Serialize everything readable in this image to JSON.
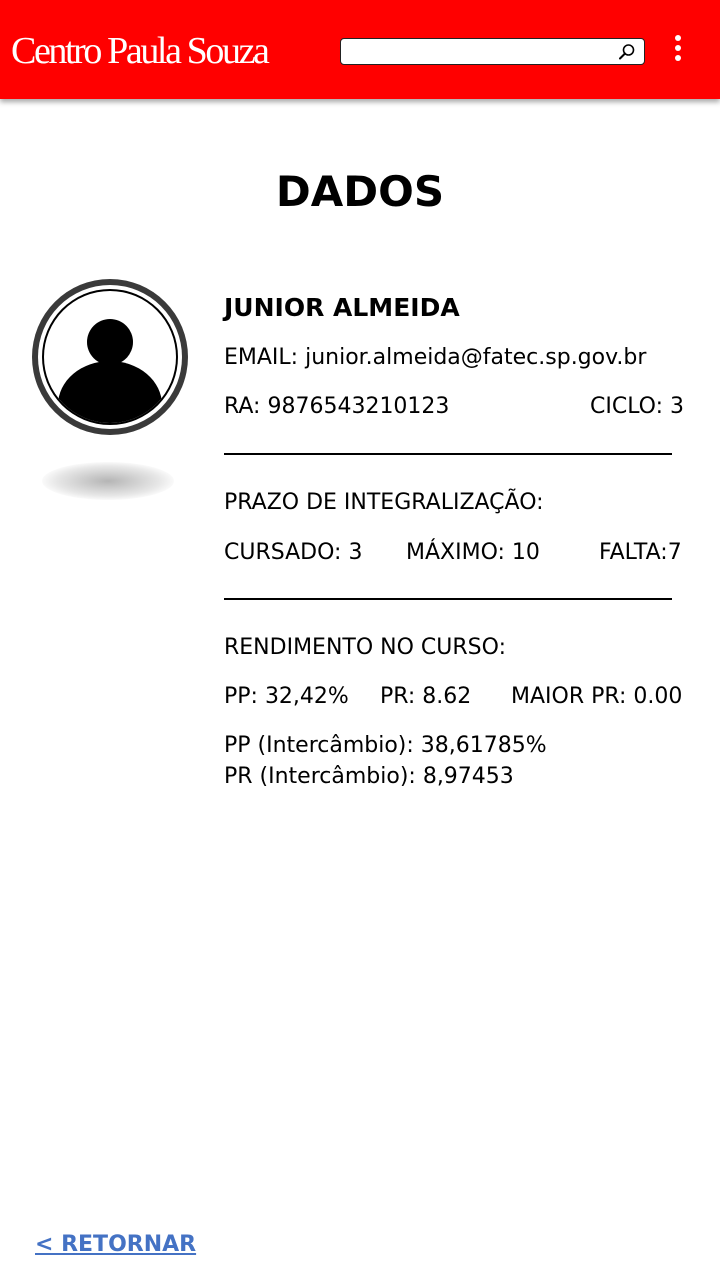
{
  "header": {
    "brand": "Centro Paula Souza",
    "search_placeholder": "",
    "search_value": "",
    "search_icon": "search-icon",
    "menu_icon": "more-vertical-icon",
    "background_color": "#ff0000"
  },
  "page": {
    "title": "DADOS"
  },
  "profile": {
    "avatar_icon": "user-avatar-icon",
    "name": "JUNIOR ALMEIDA",
    "email": "EMAIL: junior.almeida@fatec.sp.gov.br",
    "ra": "RA: 9876543210123",
    "ciclo": "CICLO: 3"
  },
  "integralizacao": {
    "heading": "PRAZO DE INTEGRALIZAÇÃO:",
    "cursado": "CURSADO: 3",
    "maximo": "MÁXIMO: 10",
    "falta": "FALTA:7"
  },
  "rendimento": {
    "heading": "RENDIMENTO NO CURSO:",
    "pp": "PP: 32,42%",
    "pr": "PR: 8.62",
    "maior_pr": "MAIOR PR: 0.00",
    "pp_intercambio": "PP (Intercâmbio): 38,61785%",
    "pr_intercambio": "PR (Intercâmbio): 8,97453"
  },
  "footer": {
    "return_label": "< RETORNAR",
    "link_color": "#4472c4"
  }
}
